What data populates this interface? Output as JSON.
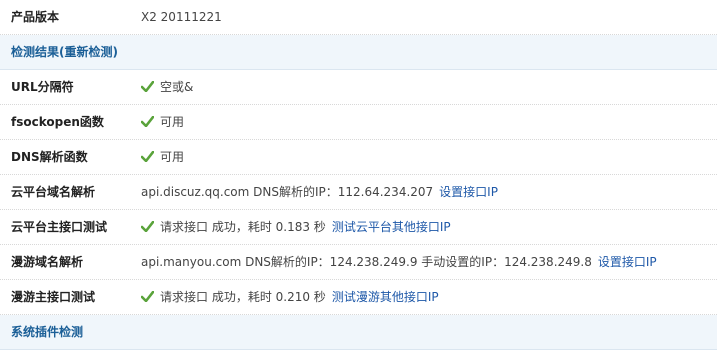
{
  "product_version": {
    "label": "产品版本",
    "value": "X2 20111221"
  },
  "results_header": {
    "title": "检测结果(重新检测)"
  },
  "checks": [
    {
      "label": "URL分隔符",
      "result": "空或&"
    },
    {
      "label": "fsockopen函数",
      "result": "可用"
    },
    {
      "label": "DNS解析函数",
      "result": "可用"
    }
  ],
  "cloud_domain": {
    "label": "云平台域名解析",
    "text": "api.discuz.qq.com DNS解析的IP：112.64.234.207",
    "link": "设置接口IP"
  },
  "cloud_api": {
    "label": "云平台主接口测试",
    "status": "请求接口 成功，耗时 0.183 秒",
    "link": "测试云平台其他接口IP"
  },
  "manyou_domain": {
    "label": "漫游域名解析",
    "text": "api.manyou.com DNS解析的IP：124.238.249.9 手动设置的IP：124.238.249.8",
    "link": "设置接口IP"
  },
  "manyou_api": {
    "label": "漫游主接口测试",
    "status": "请求接口 成功，耗时 0.210 秒",
    "link": "测试漫游其他接口IP"
  },
  "plugins_header": {
    "title": "系统插件检测"
  },
  "colors": {
    "accent": "#1b5f97",
    "link": "#1e58a8",
    "check": "#5aa33b",
    "section_bg": "#f0f6fb"
  },
  "icons": {
    "check": "check-icon"
  }
}
